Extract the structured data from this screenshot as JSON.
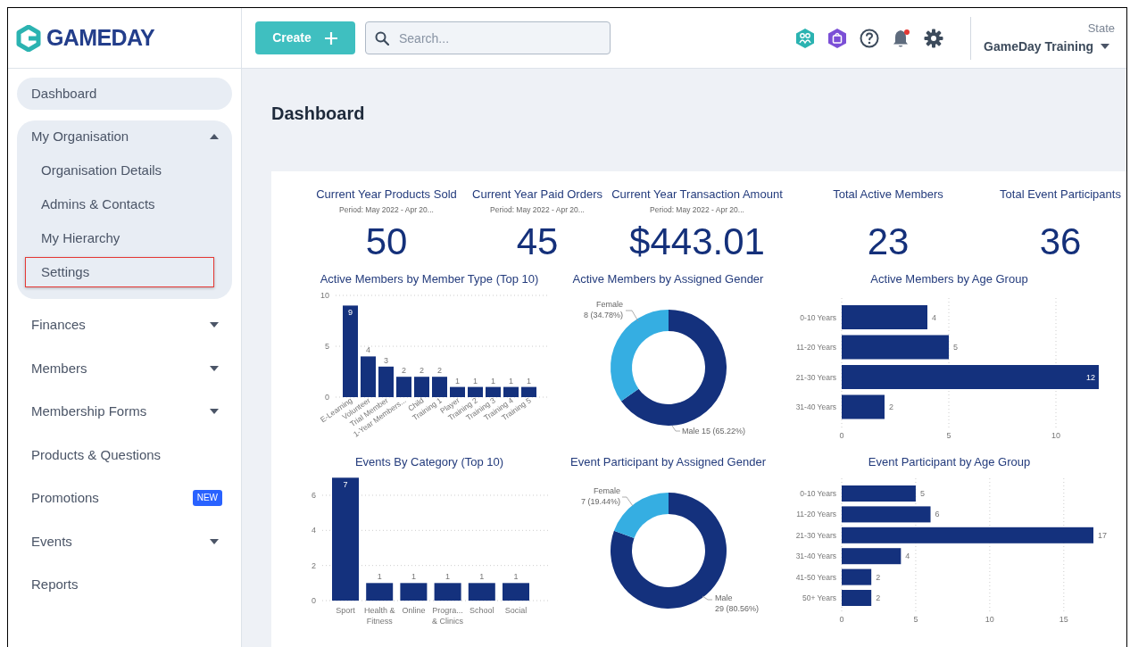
{
  "header": {
    "logo": "GAMEDAY",
    "create_button": "Create",
    "search": {
      "placeholder": "Search..."
    },
    "account": {
      "label": "State",
      "name": "GameDay Training"
    }
  },
  "sidebar": {
    "items": [
      {
        "kind": "link",
        "label": "Dashboard",
        "selected": true
      },
      {
        "kind": "group",
        "label": "My Organisation",
        "selected": false,
        "expanded": true,
        "children": [
          {
            "label": "Organisation Details",
            "highlighted": false
          },
          {
            "label": "Admins & Contacts",
            "highlighted": false
          },
          {
            "label": "My Hierarchy",
            "highlighted": false
          },
          {
            "label": "Settings",
            "highlighted": true
          }
        ]
      },
      {
        "kind": "group",
        "label": "Finances",
        "selected": false,
        "expanded": false
      },
      {
        "kind": "group",
        "label": "Members",
        "selected": false,
        "expanded": false
      },
      {
        "kind": "group",
        "label": "Membership Forms",
        "selected": false,
        "expanded": false
      },
      {
        "kind": "link",
        "label": "Products & Questions",
        "selected": false
      },
      {
        "kind": "link",
        "label": "Promotions",
        "selected": false,
        "badge": "NEW"
      },
      {
        "kind": "group",
        "label": "Events",
        "selected": false,
        "expanded": false
      },
      {
        "kind": "link",
        "label": "Reports",
        "selected": false
      }
    ]
  },
  "page_title": "Dashboard",
  "kpis": [
    {
      "title": "Current Year Products Sold",
      "period": "Period: May 2022 - Apr 20...",
      "value": "50"
    },
    {
      "title": "Current Year Paid Orders",
      "period": "Period: May 2022 - Apr 20...",
      "value": "45"
    },
    {
      "title": "Current Year Transaction Amount",
      "period": "Period: May 2022 - Apr 20...",
      "value": "$443.01"
    },
    {
      "title": "Total Active Members",
      "value": "23"
    },
    {
      "title": "Total Event Participants",
      "value": "36"
    }
  ],
  "charts": [
    {
      "chart_data": {
        "type": "bar",
        "orientation": "vertical",
        "title": "Active Members by Member Type (Top 10)",
        "categories": [
          "E-Learning",
          "Volunteer",
          "Trial Member",
          "1-Year Members...",
          "Child",
          "Training 1",
          "Player",
          "Training 2",
          "Training 3",
          "Training 4",
          "Training 5"
        ],
        "values": [
          9,
          4,
          3,
          2,
          2,
          2,
          1,
          1,
          1,
          1,
          1
        ],
        "ylim": [
          0,
          10
        ],
        "yticks": [
          0,
          5,
          10
        ],
        "grid": true,
        "data_labels": true
      }
    },
    {
      "chart_data": {
        "type": "donut",
        "title": "Active Members by Assigned Gender",
        "categories": [
          "Female",
          "Male"
        ],
        "values": [
          8,
          15
        ],
        "value_labels": [
          "8 (34.78%)",
          "15 (65.22%)"
        ]
      }
    },
    {
      "chart_data": {
        "type": "bar",
        "orientation": "horizontal",
        "title": "Active Members by Age Group",
        "categories": [
          "0-10 Years",
          "11-20 Years",
          "21-30 Years",
          "31-40 Years"
        ],
        "values": [
          4,
          5,
          12,
          2
        ],
        "xlim": [
          0,
          12
        ],
        "xticks": [
          0,
          5,
          10
        ],
        "grid": true,
        "data_labels": true
      }
    },
    {
      "chart_data": {
        "type": "bar",
        "orientation": "vertical",
        "title": "Events By Category (Top 10)",
        "categories": [
          "Sport",
          "Health & Fitness",
          "Online",
          "Progra... & Clinics",
          "School",
          "Social"
        ],
        "values": [
          7,
          1,
          1,
          1,
          1,
          1
        ],
        "ylim": [
          0,
          7
        ],
        "yticks": [
          0,
          2,
          4,
          6
        ],
        "grid": true,
        "data_labels": true
      }
    },
    {
      "chart_data": {
        "type": "donut",
        "title": "Event Participant by Assigned Gender",
        "categories": [
          "Female",
          "Male"
        ],
        "values": [
          7,
          29
        ],
        "value_labels": [
          "7 (19.44%)",
          "29 (80.56%)"
        ]
      }
    },
    {
      "chart_data": {
        "type": "bar",
        "orientation": "horizontal",
        "title": "Event Participant by Age Group",
        "categories": [
          "0-10 Years",
          "11-20 Years",
          "21-30 Years",
          "31-40 Years",
          "41-50 Years",
          "50+ Years"
        ],
        "values": [
          5,
          6,
          17,
          4,
          2,
          2
        ],
        "xlim": [
          0,
          17
        ],
        "xticks": [
          0,
          5,
          10,
          15
        ],
        "grid": true,
        "data_labels": true
      }
    }
  ]
}
